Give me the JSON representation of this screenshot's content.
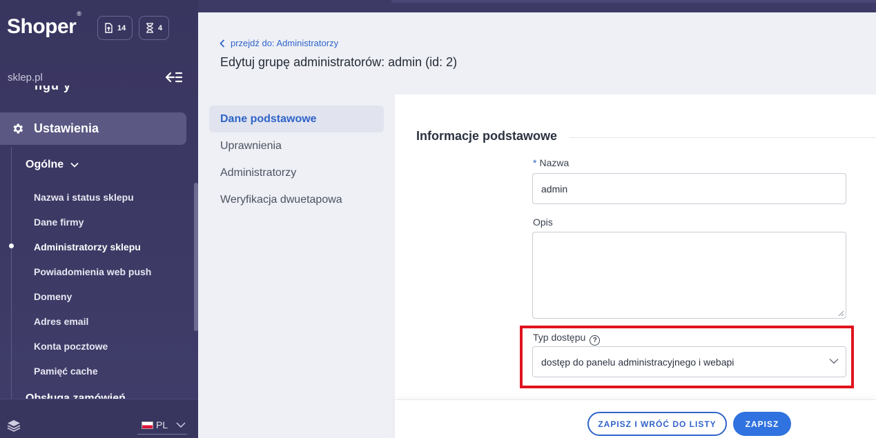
{
  "sidebar": {
    "logo": "Shoper",
    "logo_mark": "®",
    "badges": [
      {
        "icon": "file-upload-icon",
        "count": "14"
      },
      {
        "icon": "hourglass-icon",
        "count": "4"
      }
    ],
    "shop_name": "sklep.pl",
    "cut_text": "ngu y",
    "active_section": "Ustawienia",
    "group_label": "Ogólne",
    "sub_items": [
      "Nazwa i status sklepu",
      "Dane firmy",
      "Administratorzy sklepu",
      "Powiadomienia web push",
      "Domeny",
      "Adres email",
      "Konta pocztowe",
      "Pamięć cache"
    ],
    "active_sub_index": 2,
    "next_group_label": "Obsługa zamówień",
    "language": "PL"
  },
  "main": {
    "back_link": "przejdź do: Administratorzy",
    "page_title": "Edytuj grupę administratorów: admin (id: 2)",
    "tabs": [
      "Dane podstawowe",
      "Uprawnienia",
      "Administratorzy",
      "Weryfikacja dwuetapowa"
    ],
    "active_tab_index": 0,
    "form": {
      "section_title": "Informacje podstawowe",
      "required_mark": "*",
      "name_label": "Nazwa",
      "name_value": "admin",
      "description_label": "Opis",
      "description_value": "",
      "access_label": "Typ dostępu",
      "help_glyph": "?",
      "access_value": "dostęp do panelu administracyjnego i webapi"
    },
    "buttons": {
      "save_and_return": "ZAPISZ I WRÓĆ DO LISTY",
      "save": "ZAPISZ"
    }
  },
  "colors": {
    "sidebar_bg": "#38355f",
    "accent": "#2f63c9",
    "primary_button": "#2f72e0",
    "highlight": "#e0141e"
  }
}
